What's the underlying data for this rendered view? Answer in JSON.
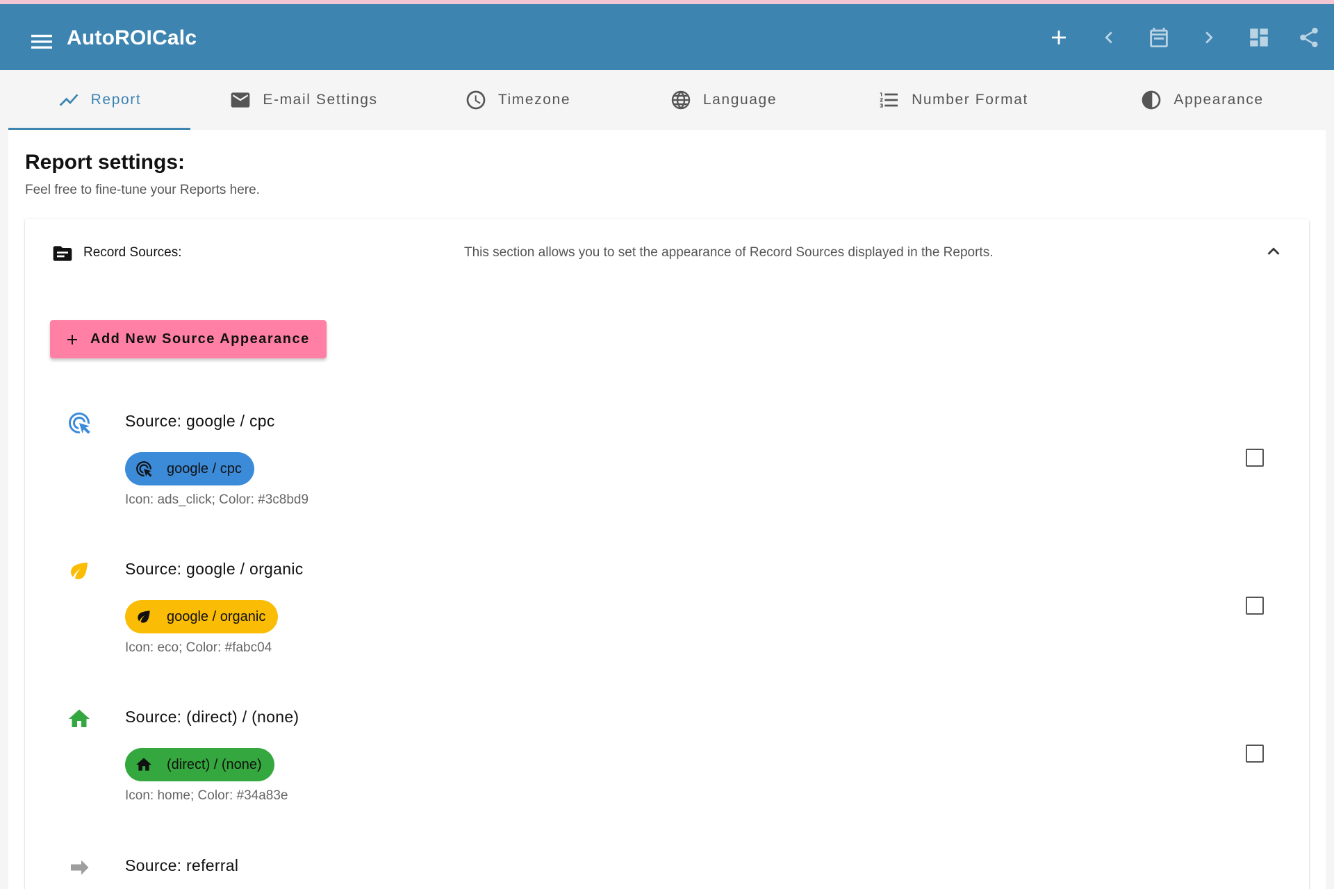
{
  "app": {
    "title": "AutoROICalc"
  },
  "tabs": [
    {
      "label": "Report",
      "icon": "trending-up-icon"
    },
    {
      "label": "E-mail Settings",
      "icon": "mail-icon"
    },
    {
      "label": "Timezone",
      "icon": "clock-icon"
    },
    {
      "label": "Language",
      "icon": "globe-icon"
    },
    {
      "label": "Number Format",
      "icon": "format-list-numbered-icon"
    },
    {
      "label": "Appearance",
      "icon": "contrast-icon"
    }
  ],
  "page": {
    "title": "Report settings:",
    "subtitle": "Feel free to fine-tune your Reports here."
  },
  "panel": {
    "title": "Record Sources:",
    "description": "This section allows you to set the appearance of Record Sources displayed in the Reports.",
    "add_button_label": "Add New Source Appearance"
  },
  "sources": [
    {
      "title": "Source: google / cpc",
      "chip_label": "google / cpc",
      "meta": "Icon: ads_click; Color: #3c8bd9",
      "icon": "ads-click-icon",
      "color": "#3c8bd9"
    },
    {
      "title": "Source: google / organic",
      "chip_label": "google / organic",
      "meta": "Icon: eco; Color: #fabc04",
      "icon": "eco-icon",
      "color": "#fabc04"
    },
    {
      "title": "Source: (direct) / (none)",
      "chip_label": "(direct) / (none)",
      "meta": "Icon: home; Color: #34a83e",
      "icon": "home-icon",
      "color": "#34a83e"
    },
    {
      "title": "Source: referral",
      "icon": "arrow-forward-icon",
      "color": "#9e9e9e"
    }
  ],
  "colors": {
    "appbar": "#3d84b1",
    "accent_button": "#ff80a4",
    "top_strip": "#f3c6d3"
  }
}
